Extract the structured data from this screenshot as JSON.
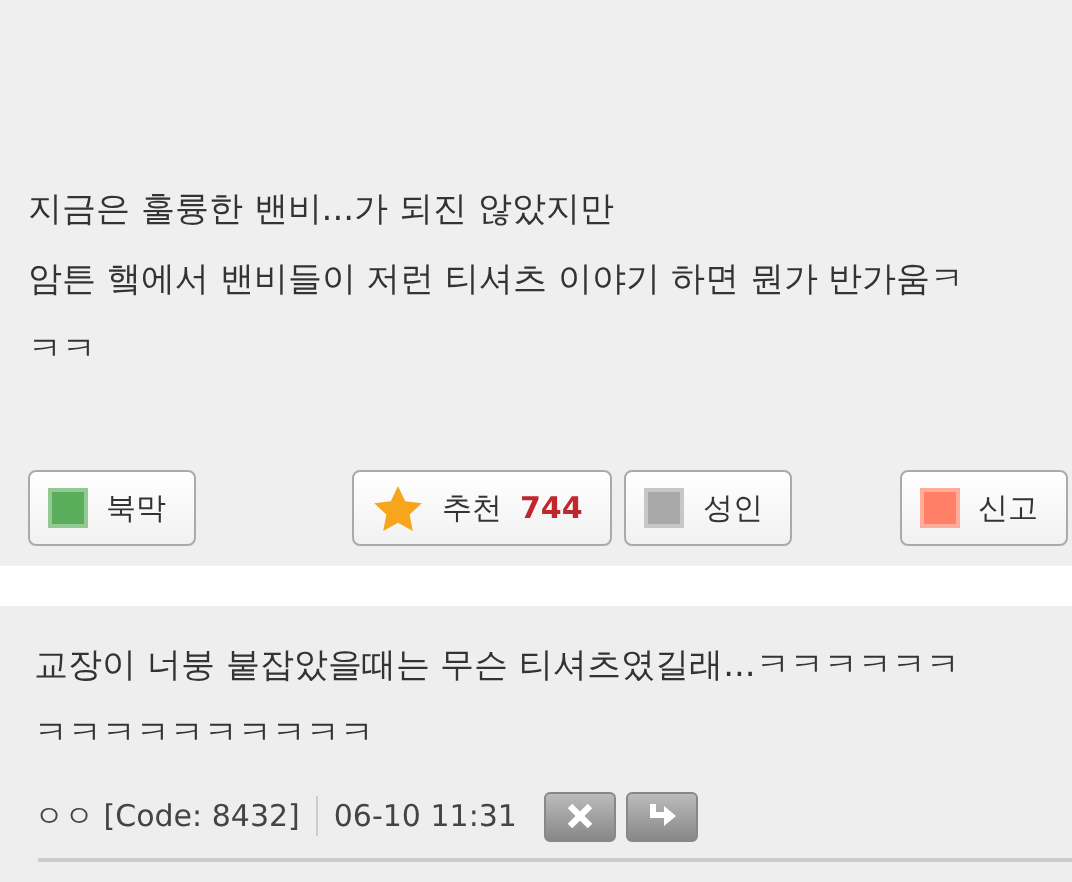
{
  "post": {
    "lines": [
      "지금은 훌륭한 밴비...가 되진 않았지만",
      "암튼 햌에서 밴비들이 저런 티셔츠 이야기 하면 뭔가 반가움ㅋ",
      "ㅋㅋ"
    ],
    "actions": [
      {
        "kind": "square",
        "label": "북막",
        "color": "#5aad5a"
      },
      {
        "kind": "star",
        "label": "추천",
        "count": "744"
      },
      {
        "kind": "square",
        "label": "성인",
        "color": "#a9a9a9"
      },
      {
        "kind": "square",
        "label": "신고",
        "color": "#ff8066"
      }
    ]
  },
  "comment": {
    "lines": [
      "교장이 너붕 붙잡았을때는 무슨 티셔츠였길래...ㅋㅋㅋㅋㅋㅋ",
      "ㅋㅋㅋㅋㅋㅋㅋㅋㅋㅋ"
    ],
    "author": "ㅇㅇ",
    "code": "[Code: 8432]",
    "time": "06-10 11:31"
  }
}
